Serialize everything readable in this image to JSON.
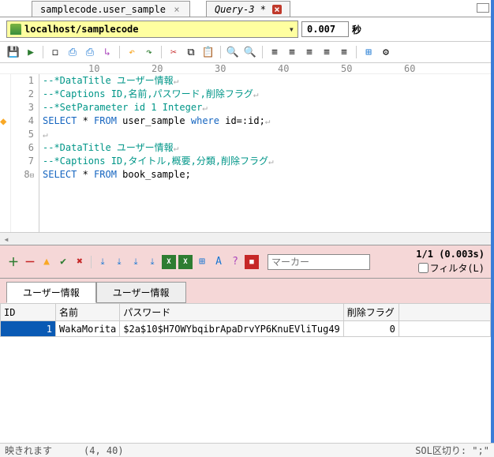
{
  "tabs": [
    {
      "label": "samplecode.user_sample",
      "close_style": "gray"
    },
    {
      "label": "Query-3 *",
      "close_style": "red",
      "italic": true
    }
  ],
  "connection": "localhost/samplecode",
  "exec_time": "0.007",
  "sec_label": "秒",
  "ruler": {
    "m10": "10",
    "m20": "20",
    "m30": "30",
    "m40": "40",
    "m50": "50",
    "m60": "60"
  },
  "code": {
    "lines": [
      {
        "n": "1",
        "segs": [
          {
            "t": "--*DataTitle ユーザー情報",
            "c": "comment"
          }
        ],
        "eol": true
      },
      {
        "n": "2",
        "segs": [
          {
            "t": "--*Captions ID,名前,パスワード,削除フラグ",
            "c": "comment"
          }
        ],
        "eol": true
      },
      {
        "n": "3",
        "segs": [
          {
            "t": "--*SetParameter id 1 Integer",
            "c": "comment"
          }
        ],
        "eol": true
      },
      {
        "n": "4",
        "segs": [
          {
            "t": "SELECT",
            "c": "keyword"
          },
          {
            "t": " * ",
            "c": "text-code"
          },
          {
            "t": "FROM",
            "c": "keyword"
          },
          {
            "t": " user_sample ",
            "c": "text-code"
          },
          {
            "t": "where",
            "c": "keyword"
          },
          {
            "t": " id=:id;",
            "c": "text-code"
          }
        ],
        "eol": true
      },
      {
        "n": "5",
        "segs": [],
        "eol": true
      },
      {
        "n": "6",
        "segs": [
          {
            "t": "--*DataTitle ユーザー情報",
            "c": "comment"
          }
        ],
        "eol": true
      },
      {
        "n": "7",
        "segs": [
          {
            "t": "--*Captions ID,タイトル,概要,分類,削除フラグ",
            "c": "comment"
          }
        ],
        "eol": true
      },
      {
        "n": "8",
        "fold": "⊟",
        "segs": [
          {
            "t": "SELECT",
            "c": "keyword"
          },
          {
            "t": " * ",
            "c": "text-code"
          },
          {
            "t": "FROM",
            "c": "keyword"
          },
          {
            "t": " book_sample;",
            "c": "text-code"
          }
        ],
        "eol": false
      }
    ]
  },
  "results": {
    "count_text": "1/1 (0.003s)",
    "filter_label": "フィルタ(L)",
    "marker_placeholder": "マーカー",
    "tabs": [
      "ユーザー情報",
      "ユーザー情報"
    ],
    "headers": [
      "ID",
      "名前",
      "パスワード",
      "削除フラグ"
    ],
    "rows": [
      {
        "id": "1",
        "name": "WakaMorita",
        "password": "$2a$10$H7OWYbqibrApaDrvYP6KnuEVliTug49",
        "del": "0"
      }
    ]
  },
  "status": {
    "left": "映きれます",
    "pos": "(4, 40)",
    "right": "SOL区切り: \";\""
  }
}
